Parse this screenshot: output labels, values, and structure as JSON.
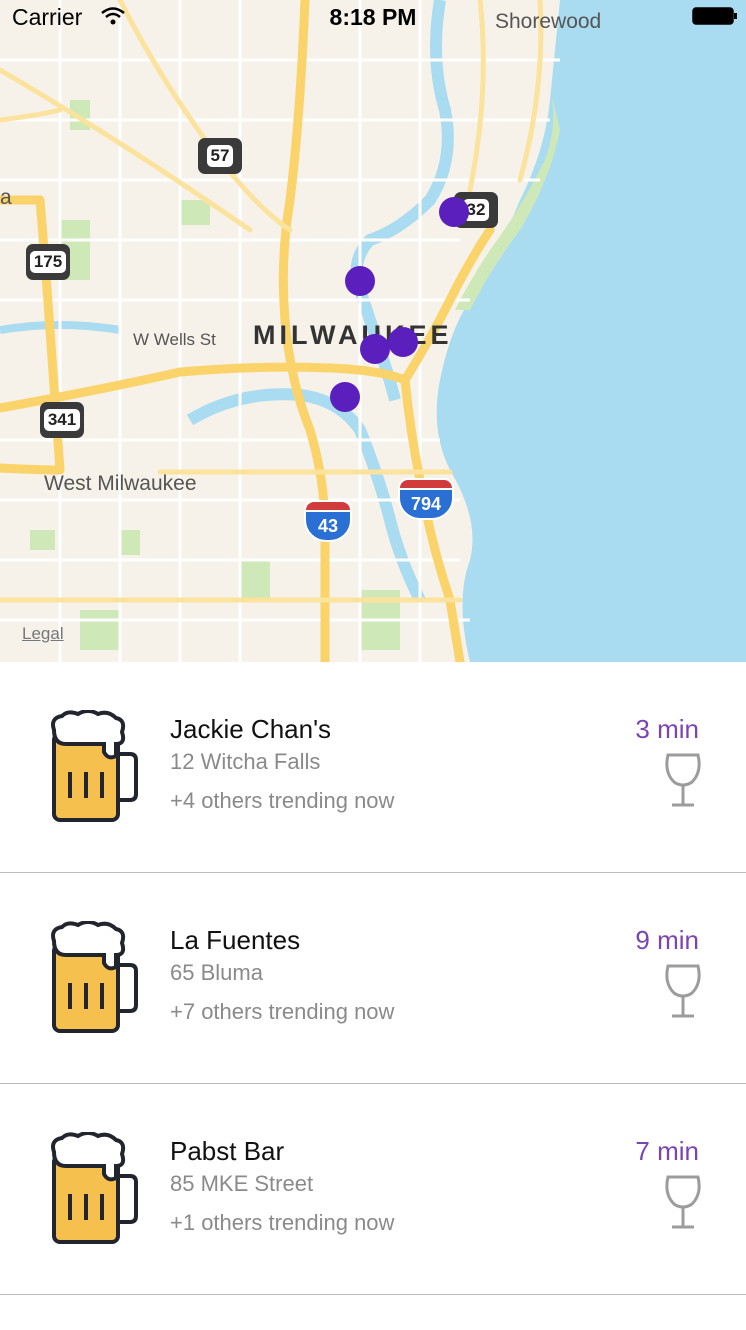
{
  "status_bar": {
    "carrier": "Carrier",
    "time": "8:18 PM"
  },
  "map": {
    "city_label": "MILWAUKEE",
    "place_labels": {
      "shorewood": "Shorewood",
      "west_milwaukee": "West Milwaukee",
      "wells_st": "W Wells St",
      "edge_a": "a"
    },
    "route_shields": [
      "57",
      "175",
      "341",
      "32"
    ],
    "interstates": [
      "43",
      "794"
    ],
    "legal": "Legal",
    "pin_color": "#5b1fbd",
    "water_color": "#a9dcf0",
    "land_color": "#f6f2e9",
    "road_color": "#fbd36b"
  },
  "bars": [
    {
      "name": "Jackie Chan's",
      "address": "12 Witcha Falls",
      "trending": "+4 others trending now",
      "eta": "3 min",
      "icon": "beer-mug-icon",
      "action_icon": "wine-glass-icon"
    },
    {
      "name": "La Fuentes",
      "address": "65 Bluma",
      "trending": "+7 others trending now",
      "eta": "9 min",
      "icon": "beer-mug-icon",
      "action_icon": "wine-glass-icon"
    },
    {
      "name": "Pabst Bar",
      "address": "85 MKE Street",
      "trending": "+1 others trending now",
      "eta": "7 min",
      "icon": "beer-mug-icon",
      "action_icon": "wine-glass-icon"
    }
  ],
  "colors": {
    "accent": "#7b44b4",
    "beer_fill": "#f6c04e",
    "beer_outline": "#22252e"
  }
}
